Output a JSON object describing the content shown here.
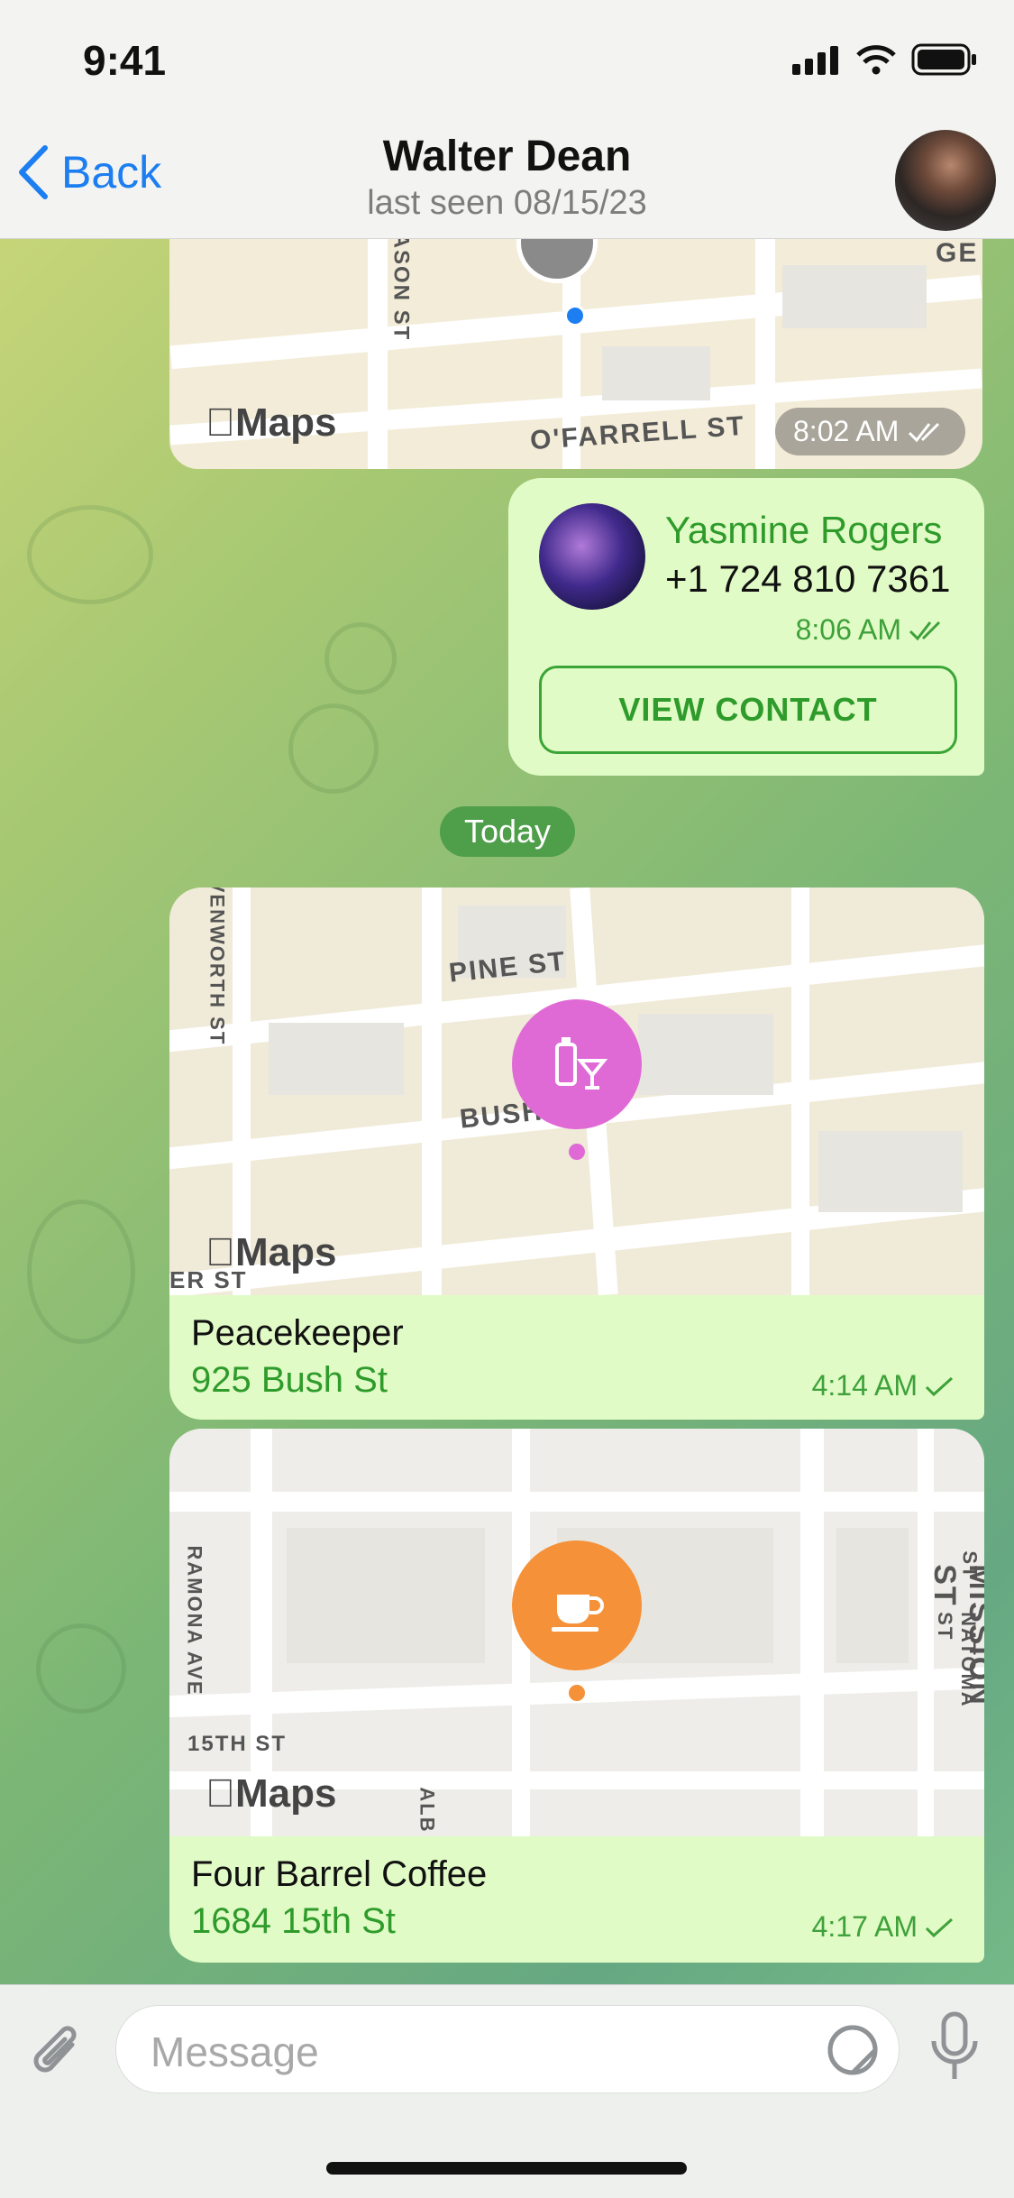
{
  "status_bar": {
    "time": "9:41"
  },
  "header": {
    "back_label": "Back",
    "title": "Walter Dean",
    "subtitle": "last seen 08/15/23"
  },
  "messages": {
    "map1": {
      "time": "8:02 AM",
      "street_a": "O'FARRELL ST",
      "street_b": "ASON ST",
      "street_c": "GE",
      "maps": "Maps"
    },
    "contact": {
      "name": "Yasmine Rogers",
      "phone": "+1 724 810 7361",
      "time": "8:06 AM",
      "button": "VIEW CONTACT"
    },
    "date_divider": "Today",
    "loc1": {
      "name": "Peacekeeper",
      "address": "925 Bush St",
      "time": "4:14 AM",
      "street_a": "PINE ST",
      "street_b": "BUSH",
      "street_c": "VENWORTH ST",
      "street_d": "ER ST",
      "maps": "Maps",
      "pin_color": "#df6ad6"
    },
    "loc2": {
      "name": "Four Barrel Coffee",
      "address": "1684 15th St",
      "time": "4:17 AM",
      "street_a": "MISSION ST",
      "street_b": "MINNA ST",
      "street_c": "NATOMA ST",
      "street_d": "RAMONA AVE",
      "street_e": "15TH ST",
      "street_f": "ALB",
      "maps": "Maps",
      "pin_color": "#f59138"
    }
  },
  "composer": {
    "placeholder": "Message"
  },
  "colors": {
    "accent": "#1c7ef0",
    "bubble_out": "#e1fbc6",
    "green_text": "#2e9b2b"
  }
}
